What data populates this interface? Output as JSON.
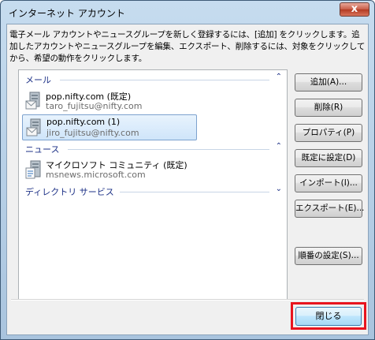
{
  "window": {
    "title": "インターネット アカウント",
    "close_glyph": "x"
  },
  "description": "電子メール アカウントやニュースグループを新しく登録するには、[追加] をクリックします。追加したアカウントやニュースグループを編集、エクスポート、削除するには、対象をクリックしてから、希望の動作をクリックします。",
  "groups": {
    "mail": {
      "label": "メール",
      "items": [
        {
          "name": "pop.nifty.com (既定)",
          "sub": "taro_fujitsu@nifty.com",
          "selected": false
        },
        {
          "name": "pop.nifty.com (1)",
          "sub": "jiro_fujitsu@nifty.com",
          "selected": true
        }
      ]
    },
    "news": {
      "label": "ニュース",
      "items": [
        {
          "name": "マイクロソフト コミュニティ (既定)",
          "sub": "msnews.microsoft.com",
          "selected": false
        }
      ]
    },
    "directory": {
      "label": "ディレクトリ サービス"
    }
  },
  "chevrons": {
    "up": "⌃",
    "down": "⌄"
  },
  "buttons": {
    "add": "追加(A)...",
    "remove": "削除(R)",
    "properties": "プロパティ(P)",
    "set_default": "既定に設定(D)",
    "import": "インポート(I)...",
    "export": "エクスポート(E)...",
    "order": "順番の設定(S)...",
    "close": "閉じる"
  },
  "colors": {
    "highlight": "#e8141e",
    "group_label": "#1e3287",
    "selection": "#cfe5fa"
  },
  "icons": {
    "mail_account": "mail-server-icon",
    "news_account": "news-server-icon"
  }
}
